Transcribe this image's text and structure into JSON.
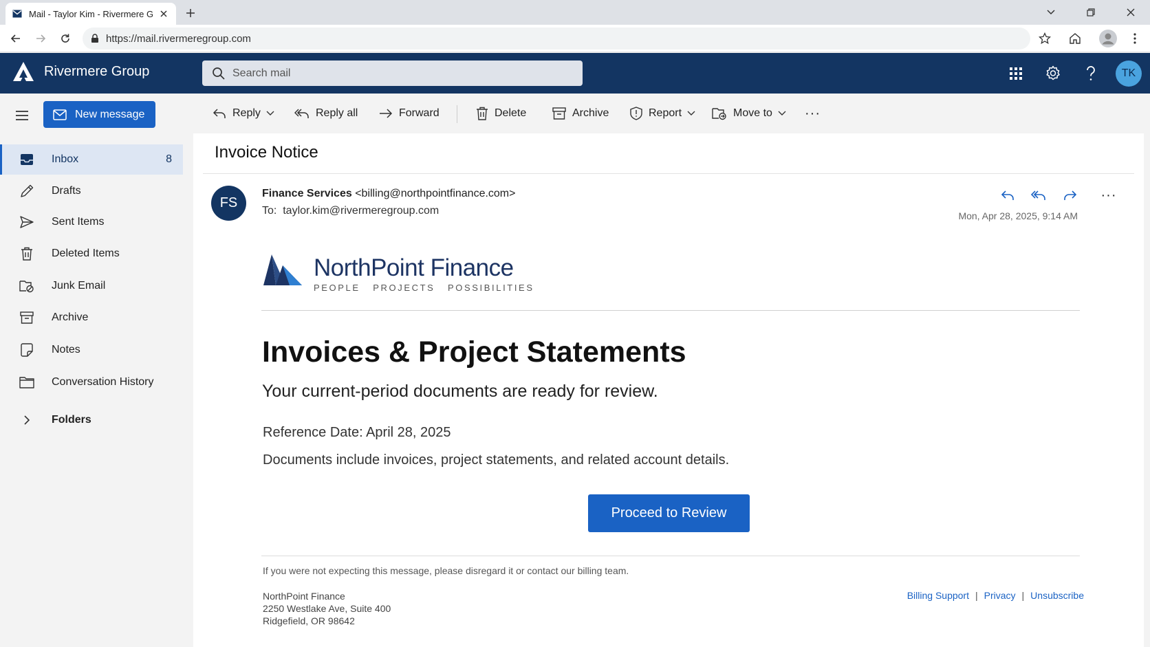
{
  "browser": {
    "tab_title": "Mail - Taylor Kim - Rivermere Gr",
    "url": "https://mail.rivermeregroup.com"
  },
  "header": {
    "brand": "Rivermere Group",
    "search_placeholder": "Search mail",
    "avatar_initials": "TK"
  },
  "sidebar": {
    "new_message": "New message",
    "items": [
      {
        "label": "Inbox",
        "count": "8",
        "icon": "inbox-icon"
      },
      {
        "label": "Drafts",
        "icon": "pencil-icon"
      },
      {
        "label": "Sent Items",
        "icon": "send-icon"
      },
      {
        "label": "Deleted Items",
        "icon": "trash-icon"
      },
      {
        "label": "Junk Email",
        "icon": "junk-icon"
      },
      {
        "label": "Archive",
        "icon": "archive-icon"
      },
      {
        "label": "Notes",
        "icon": "note-icon"
      },
      {
        "label": "Conversation History",
        "icon": "folder-icon"
      },
      {
        "label": "Folders",
        "icon": "chevron-right-icon"
      }
    ]
  },
  "toolbar": {
    "reply": "Reply",
    "reply_all": "Reply all",
    "forward": "Forward",
    "delete": "Delete",
    "archive": "Archive",
    "report": "Report",
    "move_to": "Move to",
    "more": "···"
  },
  "message": {
    "subject": "Invoice Notice",
    "sender_initials": "FS",
    "sender_name": "Finance Services",
    "sender_email": "<billing@northpointfinance.com>",
    "to_label": "To:",
    "to_address": "taylor.kim@rivermeregroup.com",
    "date": "Mon, Apr 28, 2025, 9:14 AM",
    "more": "···",
    "body": {
      "logo_name": "NorthPoint Finance",
      "logo_tagline": "PEOPLE   PROJECTS   POSSIBILITIES",
      "heading": "Invoices & Project Statements",
      "subheading": "Your current-period documents are ready for review.",
      "reference_date": "Reference Date: April 28, 2025",
      "documents_note": "Documents include invoices, project statements, and related account details.",
      "cta": "Proceed to Review",
      "disclaimer": "If you were not expecting this message, please disregard it or contact our billing team.",
      "address": {
        "line1": "NorthPoint Finance",
        "line2": "2250 Westlake Ave, Suite 400",
        "line3": "Ridgefield, OR 98642"
      },
      "footer_links": {
        "billing": "Billing Support",
        "privacy": "Privacy",
        "unsubscribe": "Unsubscribe",
        "separator": "|"
      }
    }
  },
  "colors": {
    "header_navy": "#133562",
    "accent_blue": "#1a62c4",
    "avatar_blue": "#4aa3df"
  }
}
